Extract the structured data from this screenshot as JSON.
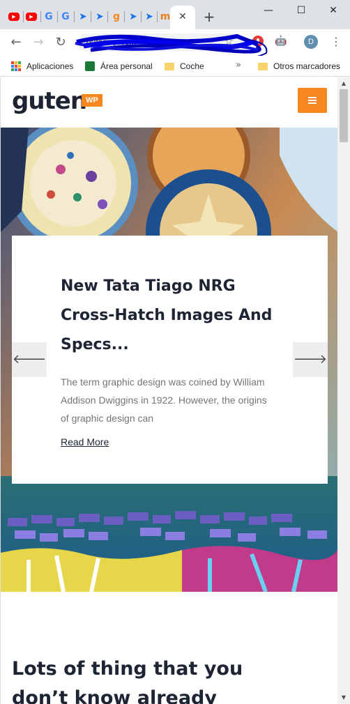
{
  "browser": {
    "tabs": [
      {
        "icon": "youtube-icon",
        "glyph": "▶"
      },
      {
        "icon": "youtube-icon",
        "glyph": "▶"
      },
      {
        "icon": "google-icon",
        "glyph": "G"
      },
      {
        "icon": "google-icon",
        "glyph": "G"
      },
      {
        "icon": "pin-icon",
        "glyph": "➤"
      },
      {
        "icon": "pin-icon",
        "glyph": "➤"
      },
      {
        "icon": "gutenwp-icon",
        "glyph": "g"
      },
      {
        "icon": "pin-icon",
        "glyph": "➤"
      },
      {
        "icon": "pin-icon",
        "glyph": "➤"
      },
      {
        "icon": "moodle-icon",
        "glyph": "m"
      }
    ],
    "active_tab_close": "✕",
    "new_tab": "+",
    "window_buttons": {
      "minimize": "—",
      "maximize": "☐",
      "close": "✕"
    },
    "nav": {
      "back": "←",
      "forward": "→",
      "reload": "↻"
    },
    "url": "gutenwp.com",
    "star": "☆",
    "avatar_letter": "D",
    "menu": "⋮",
    "android_ext": "🤖"
  },
  "bookmarks": {
    "apps": "Aplicaciones",
    "area_personal": "Área personal",
    "coche": "Coche",
    "more": "»",
    "otros": "Otros marcadores"
  },
  "site": {
    "logo_text": "guten",
    "logo_badge": "WP"
  },
  "hero": {
    "title": "New Tata Tiago NRG Cross-Hatch Images And Specs...",
    "excerpt": "The term graphic design was coined by William Addison Dwiggins in 1922. However, the origins of graphic design can",
    "read_more": "Read More",
    "prev": "🡐",
    "next": "🡒"
  },
  "section": {
    "heading": "Lots of thing that you don’t know already"
  },
  "colors": {
    "accent": "#f7871e",
    "dark_text": "#1d2433",
    "muted_text": "#757575"
  },
  "scroll": {
    "up": "▲",
    "down": "▼"
  }
}
